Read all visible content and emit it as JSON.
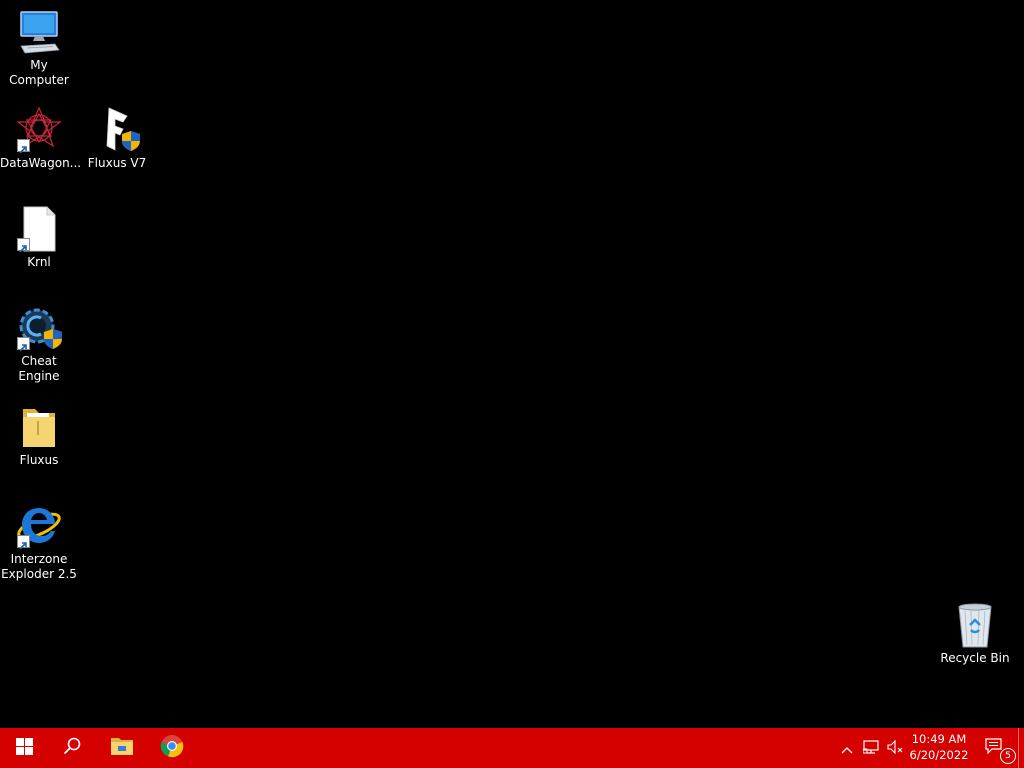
{
  "desktop": {
    "background_color": "#000000",
    "icons": [
      {
        "label": "My Computer",
        "icon": "computer-icon",
        "shortcut": false
      },
      {
        "label": "DataWagon...",
        "icon": "datawagon-icon",
        "shortcut": true
      },
      {
        "label": "Fluxus V7",
        "icon": "fluxus-v7-icon",
        "shortcut": false
      },
      {
        "label": "Krnl",
        "icon": "file-icon",
        "shortcut": true
      },
      {
        "label": "Cheat Engine",
        "icon": "cheat-engine-icon",
        "shortcut": true
      },
      {
        "label": "Fluxus",
        "icon": "folder-icon",
        "shortcut": false
      },
      {
        "label": "Interzone\nExploder 2.5",
        "icon": "internet-explorer-icon",
        "shortcut": true
      },
      {
        "label": "Recycle Bin",
        "icon": "recycle-bin-icon",
        "shortcut": false
      }
    ]
  },
  "taskbar": {
    "color": "#d50000",
    "start_icon": "windows-logo-icon",
    "search_icon": "search-icon",
    "pinned": [
      {
        "name": "file-explorer",
        "icon": "folder-icon"
      },
      {
        "name": "chrome",
        "icon": "chrome-icon"
      }
    ],
    "tray": {
      "show_hidden_icon": "chevron-up-icon",
      "network_icon": "network-icon",
      "volume_icon": "volume-muted-icon",
      "time": "10:49 AM",
      "date": "6/20/2022",
      "notification_icon": "notification-icon",
      "notification_count": "5"
    }
  }
}
